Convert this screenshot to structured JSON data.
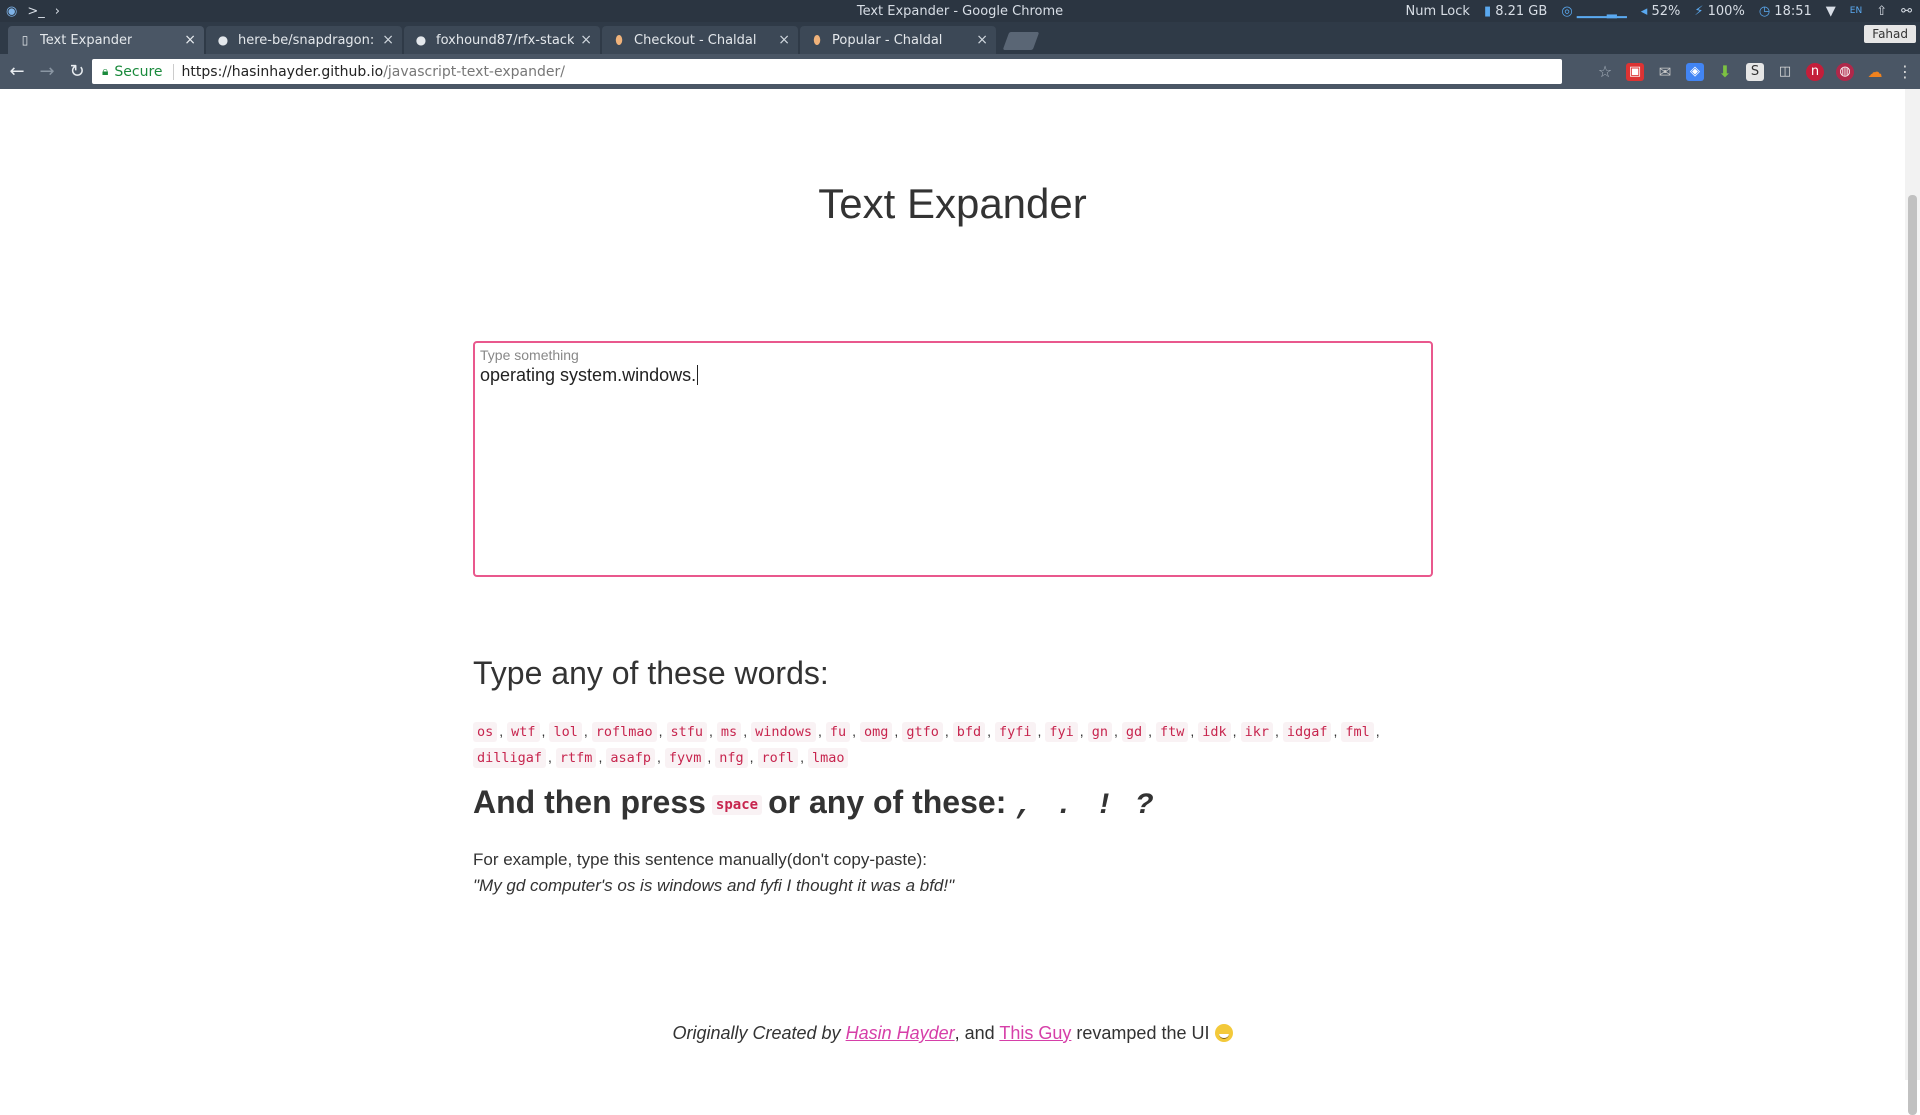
{
  "os": {
    "window_title": "Text Expander - Google Chrome",
    "num_lock": "Num Lock",
    "memory": "8.21 GB",
    "volume": "52%",
    "battery": "100%",
    "clock": "18:51",
    "lang": "EN"
  },
  "browser": {
    "tabs": [
      {
        "label": "Text Expander",
        "icon": "page-icon",
        "active": true
      },
      {
        "label": "here-be/snapdragon: s",
        "icon": "github-icon",
        "active": false
      },
      {
        "label": "foxhound87/rfx-stack:",
        "icon": "github-icon",
        "active": false
      },
      {
        "label": "Checkout - Chaldal",
        "icon": "egg-icon",
        "active": false
      },
      {
        "label": "Popular - Chaldal",
        "icon": "egg-icon",
        "active": false
      }
    ],
    "profile_name": "Fahad",
    "secure_label": "Secure",
    "url_scheme_host": "https://hasinhayder.github.io",
    "url_path": "/javascript-text-expander/"
  },
  "page": {
    "title": "Text Expander",
    "textarea_label": "Type something",
    "textarea_value": "operating system.windows.",
    "words_heading": "Type any of these words:",
    "words": [
      "os",
      "wtf",
      "lol",
      "roflmao",
      "stfu",
      "ms",
      "windows",
      "fu",
      "omg",
      "gtfo",
      "bfd",
      "fyfi",
      "fyi",
      "gn",
      "gd",
      "ftw",
      "idk",
      "ikr",
      "idgaf",
      "fml",
      "dilligaf",
      "rtfm",
      "asafp",
      "fyvm",
      "nfg",
      "rofl",
      "lmao"
    ],
    "then_prefix": "And then press",
    "then_key": "space",
    "then_middle": "or any of these:",
    "then_punct": ", . ! ?",
    "example_intro": "For example, type this sentence manually(don't copy-paste):",
    "example_sentence": "\"My gd computer's os is windows and fyfi I thought it was a bfd!\"",
    "footer": {
      "prefix": "Originally Created by",
      "author_link": "Hasin Hayder",
      "middle": ", and",
      "revamp_link": "This Guy",
      "suffix": "revamped the UI"
    }
  }
}
